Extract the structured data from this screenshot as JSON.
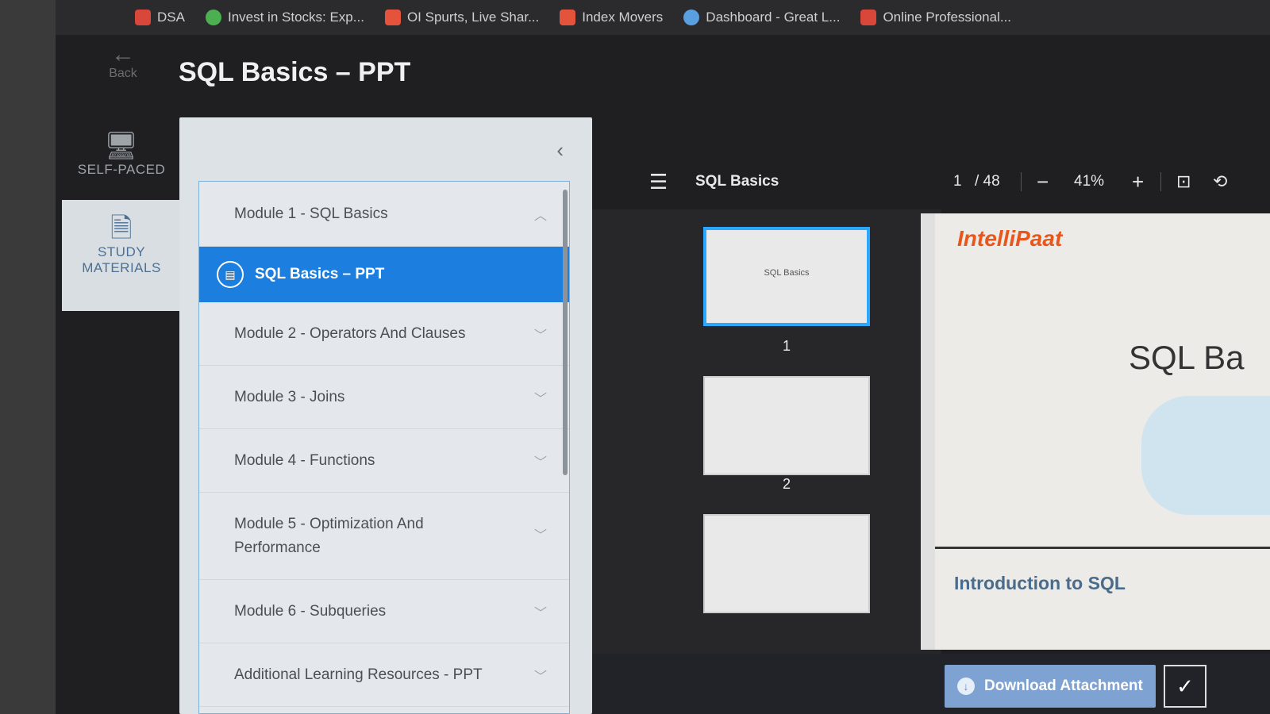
{
  "bookmarks": [
    {
      "label": "DSA",
      "color": "#d9463a"
    },
    {
      "label": "Invest in Stocks: Exp...",
      "color": "#4caf50"
    },
    {
      "label": "OI Spurts, Live Shar...",
      "color": "#e5533d"
    },
    {
      "label": "Index Movers",
      "color": "#e5533d"
    },
    {
      "label": "Dashboard - Great L...",
      "color": "#5aa0e0"
    },
    {
      "label": "Online Professional...",
      "color": "#d9463a"
    }
  ],
  "header": {
    "back_label": "Back",
    "title": "SQL Basics – PPT"
  },
  "leftnav": {
    "self_paced_label": "SELF-PACED",
    "study_materials_label": "STUDY MATERIALS"
  },
  "modules": {
    "m1": "Module 1 - SQL Basics",
    "lesson": "SQL Basics – PPT",
    "m2": "Module 2 - Operators And Clauses",
    "m3": "Module 3 - Joins",
    "m4": "Module 4 - Functions",
    "m5": "Module 5 - Optimization And Performance",
    "m6": "Module 6 - Subqueries",
    "m7": "Additional Learning Resources - PPT"
  },
  "viewer": {
    "doc_name": "SQL Basics",
    "page_current": "1",
    "page_total": "/ 48",
    "zoom": "41%",
    "thumb1_label": "SQL Basics",
    "thumb1_num": "1",
    "thumb2_num": "2"
  },
  "slide": {
    "logo": "IntelliPaat",
    "title": "SQL Ba",
    "footer": "Introduction to SQL"
  },
  "actions": {
    "download_label": "Download Attachment"
  },
  "colors": {
    "accent": "#1c7fe0",
    "logo": "#e8561b"
  }
}
